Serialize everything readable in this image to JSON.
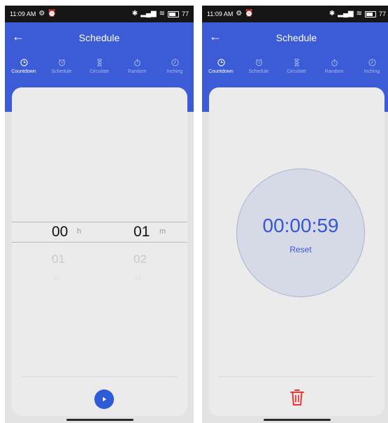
{
  "screens": [
    {
      "status": {
        "time": "11:09 AM",
        "battery": "77"
      },
      "title": "Schedule",
      "tabs": [
        "Countdown",
        "Schedule",
        "Circulate",
        "Random",
        "Inching"
      ],
      "picker": {
        "hours": {
          "selected": "00",
          "next": "01",
          "next2": "02",
          "unit": "h"
        },
        "minutes": {
          "selected": "01",
          "next": "02",
          "next2": "03",
          "unit": "m"
        }
      }
    },
    {
      "status": {
        "time": "11:09 AM",
        "battery": "77"
      },
      "title": "Schedule",
      "tabs": [
        "Countdown",
        "Schedule",
        "Circulate",
        "Random",
        "Inching"
      ],
      "timer": {
        "display": "00:00:59",
        "reset_label": "Reset"
      }
    }
  ],
  "colors": {
    "primary": "#3c5bd7",
    "accent_text": "#3557d4",
    "danger": "#e53935",
    "card_bg": "#ebebec"
  },
  "icons": {
    "tabs": [
      "clock-icon",
      "alarm-clock-icon",
      "hourglass-icon",
      "stopwatch-icon",
      "timer-icon"
    ],
    "back": "back-arrow-icon",
    "play": "play-icon",
    "delete": "trash-icon"
  }
}
